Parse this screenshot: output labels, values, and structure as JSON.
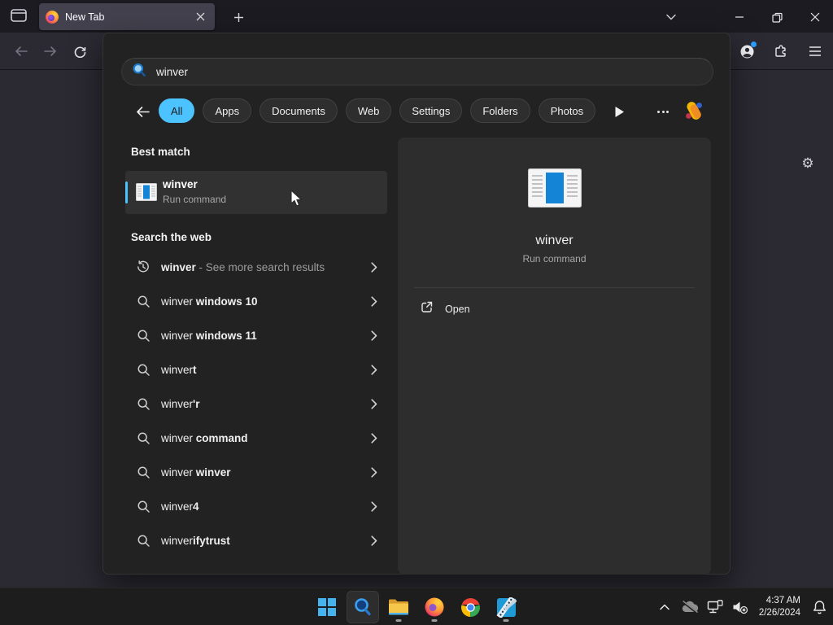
{
  "accent": "#4cc2ff",
  "browser": {
    "tab_label": "New Tab"
  },
  "flyout": {
    "query": "winver",
    "filters": [
      {
        "label": "All",
        "selected": true
      },
      {
        "label": "Apps",
        "selected": false
      },
      {
        "label": "Documents",
        "selected": false
      },
      {
        "label": "Web",
        "selected": false
      },
      {
        "label": "Settings",
        "selected": false
      },
      {
        "label": "Folders",
        "selected": false
      },
      {
        "label": "Photos",
        "selected": false
      }
    ],
    "best_match_header": "Best match",
    "best_match": {
      "title": "winver",
      "subtitle": "Run command"
    },
    "web_header": "Search the web",
    "web_items": [
      {
        "icon": "history-icon",
        "parts": [
          {
            "t": "winver",
            "b": true
          },
          {
            "t": " - See more search results",
            "muted": true
          }
        ]
      },
      {
        "icon": "search-icon",
        "parts": [
          {
            "t": "winver "
          },
          {
            "t": "windows 10",
            "b": true
          }
        ]
      },
      {
        "icon": "search-icon",
        "parts": [
          {
            "t": "winver "
          },
          {
            "t": "windows 11",
            "b": true
          }
        ]
      },
      {
        "icon": "search-icon",
        "parts": [
          {
            "t": "winver"
          },
          {
            "t": "t",
            "b": true
          }
        ]
      },
      {
        "icon": "search-icon",
        "parts": [
          {
            "t": "winver"
          },
          {
            "t": "'r",
            "b": true
          }
        ]
      },
      {
        "icon": "search-icon",
        "parts": [
          {
            "t": "winver "
          },
          {
            "t": "command",
            "b": true
          }
        ]
      },
      {
        "icon": "search-icon",
        "parts": [
          {
            "t": "winver "
          },
          {
            "t": "winver",
            "b": true
          }
        ]
      },
      {
        "icon": "search-icon",
        "parts": [
          {
            "t": "winver"
          },
          {
            "t": "4",
            "b": true
          }
        ]
      },
      {
        "icon": "search-icon",
        "parts": [
          {
            "t": "winver"
          },
          {
            "t": "ifytrust",
            "b": true
          }
        ]
      }
    ],
    "detail": {
      "title": "winver",
      "subtitle": "Run command",
      "open_label": "Open"
    }
  },
  "taskbar": {
    "buttons": [
      {
        "name": "start",
        "running": false,
        "active": false
      },
      {
        "name": "search",
        "running": false,
        "active": true
      },
      {
        "name": "file-explorer",
        "running": true,
        "active": false
      },
      {
        "name": "firefox",
        "running": true,
        "active": false
      },
      {
        "name": "chrome",
        "running": false,
        "active": false
      },
      {
        "name": "video-editor",
        "running": true,
        "active": false
      }
    ]
  },
  "tray": {
    "time": "4:37 AM",
    "date": "2/26/2024"
  }
}
